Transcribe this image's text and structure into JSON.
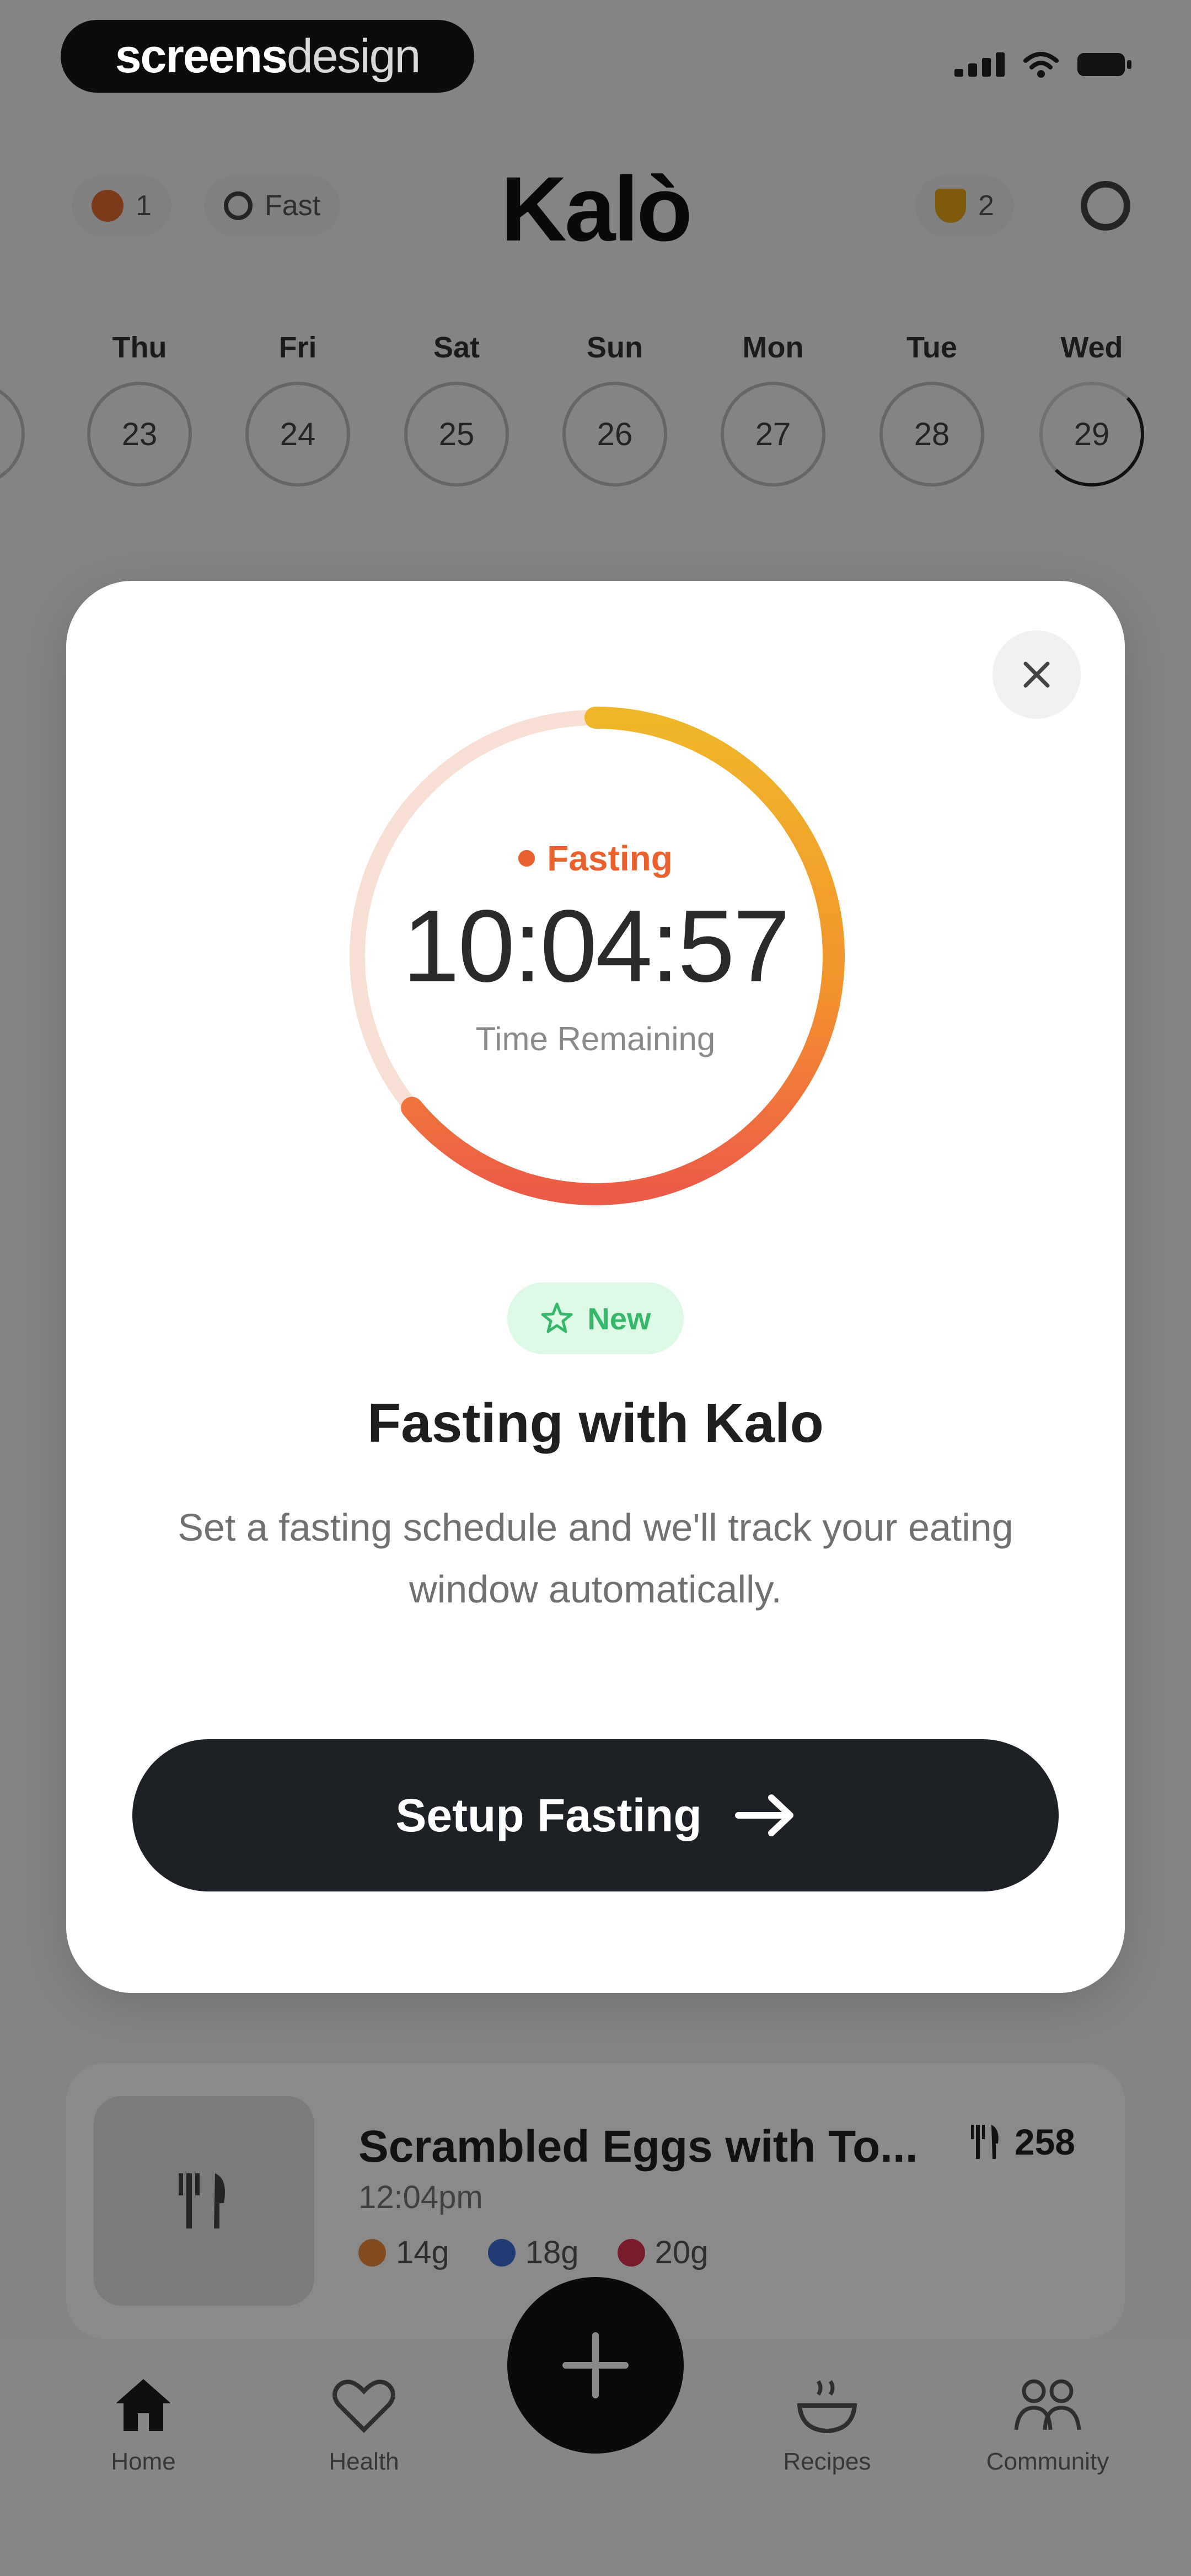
{
  "watermark": {
    "bold": "screens",
    "light": "design"
  },
  "header": {
    "streak_count": "1",
    "fast_label": "Fast",
    "logo": "Kalò",
    "trophy_count": "2"
  },
  "days": [
    {
      "name": "Thu",
      "date": "23"
    },
    {
      "name": "Fri",
      "date": "24"
    },
    {
      "name": "Sat",
      "date": "25"
    },
    {
      "name": "Sun",
      "date": "26"
    },
    {
      "name": "Mon",
      "date": "27"
    },
    {
      "name": "Tue",
      "date": "28"
    },
    {
      "name": "Wed",
      "date": "29"
    }
  ],
  "modal": {
    "status_label": "Fasting",
    "timer": "10:04:57",
    "timer_caption": "Time Remaining",
    "badge": "New",
    "title": "Fasting with Kalo",
    "description": "Set a fasting schedule and we'll track your eating window automatically.",
    "cta_label": "Setup Fasting",
    "ring_progress": 0.64
  },
  "meal": {
    "title": "Scrambled Eggs with To...",
    "time": "12:04pm",
    "calories": "258",
    "carbs": "14g",
    "fat": "18g",
    "protein": "20g"
  },
  "tabs": {
    "home": "Home",
    "health": "Health",
    "recipes": "Recipes",
    "community": "Community"
  },
  "colors": {
    "ring_orange": "#f3952c",
    "ring_yellow": "#efb629",
    "ring_red": "#e8445a",
    "ring_track": "#f7e0d3",
    "cta_bg": "#1d2126",
    "badge_bg": "#dcfae6",
    "badge_text": "#35b869"
  }
}
